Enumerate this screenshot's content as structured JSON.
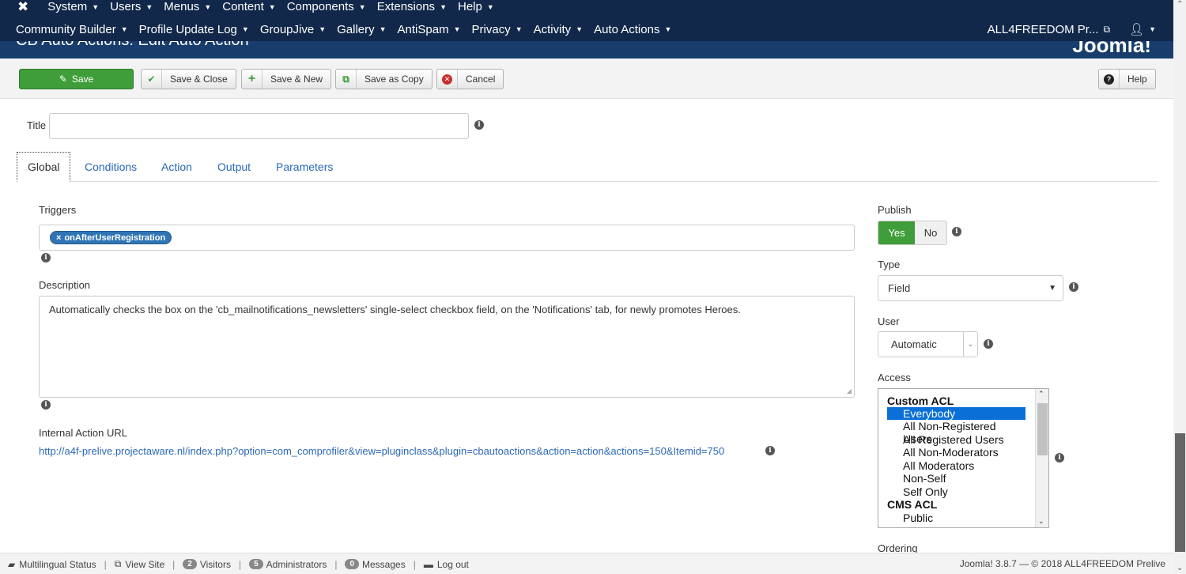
{
  "nav": {
    "row1": [
      "System",
      "Users",
      "Menus",
      "Content",
      "Components",
      "Extensions",
      "Help"
    ],
    "row2": [
      "Community Builder",
      "Profile Update Log",
      "GroupJive",
      "Gallery",
      "AntiSpam",
      "Privacy",
      "Activity",
      "Auto Actions"
    ],
    "site_name": "ALL4FREEDOM Pr...",
    "logo_icon": "joomla-icon",
    "user_icon": "user-icon"
  },
  "header": {
    "page_title": "CB Auto Actions: Edit Auto Action",
    "logo_text": "Joomla!"
  },
  "toolbar": {
    "save": "Save",
    "save_close": "Save & Close",
    "save_new": "Save & New",
    "save_copy": "Save as Copy",
    "cancel": "Cancel",
    "help": "Help"
  },
  "form": {
    "title_label": "Title",
    "title_value": "",
    "tabs": [
      "Global",
      "Conditions",
      "Action",
      "Output",
      "Parameters"
    ],
    "triggers_label": "Triggers",
    "trigger_chip": "onAfterUserRegistration",
    "description_label": "Description",
    "description_value": "Automatically checks the box on the 'cb_mailnotifications_newsletters' single-select checkbox field, on the 'Notifications' tab, for newly promotes Heroes.",
    "url_label": "Internal Action URL",
    "url_value": "http://a4f-prelive.projectaware.nl/index.php?option=com_comprofiler&view=pluginclass&plugin=cbautoactions&action=action&actions=150&Itemid=750"
  },
  "sidebar": {
    "publish_label": "Publish",
    "publish_yes": "Yes",
    "publish_no": "No",
    "publish_value": "Yes",
    "type_label": "Type",
    "type_value": "Field",
    "user_label": "User",
    "user_value": "Automatic",
    "access_label": "Access",
    "access_options": [
      {
        "text": "Custom ACL",
        "group": true
      },
      {
        "text": "Everybody",
        "selected": true
      },
      {
        "text": "All Non-Registered Users"
      },
      {
        "text": "All Registered Users"
      },
      {
        "text": "All Non-Moderators"
      },
      {
        "text": "All Moderators"
      },
      {
        "text": "Non-Self"
      },
      {
        "text": "Self Only"
      },
      {
        "text": "CMS ACL",
        "group": true
      },
      {
        "text": "Public"
      }
    ],
    "ordering_label": "Ordering"
  },
  "status": {
    "multilingual": "Multilingual Status",
    "view_site": "View Site",
    "visitors_count": "2",
    "visitors": "Visitors",
    "admins_count": "5",
    "admins": "Administrators",
    "messages_count": "0",
    "messages": "Messages",
    "logout": "Log out",
    "version": "Joomla! 3.8.7 — © 2018 ALL4FREEDOM Prelive"
  },
  "colors": {
    "nav_bg": "#12284a",
    "save_green": "#3f9e3a",
    "link_blue": "#2a69b8",
    "chip_blue": "#2f75b5"
  }
}
